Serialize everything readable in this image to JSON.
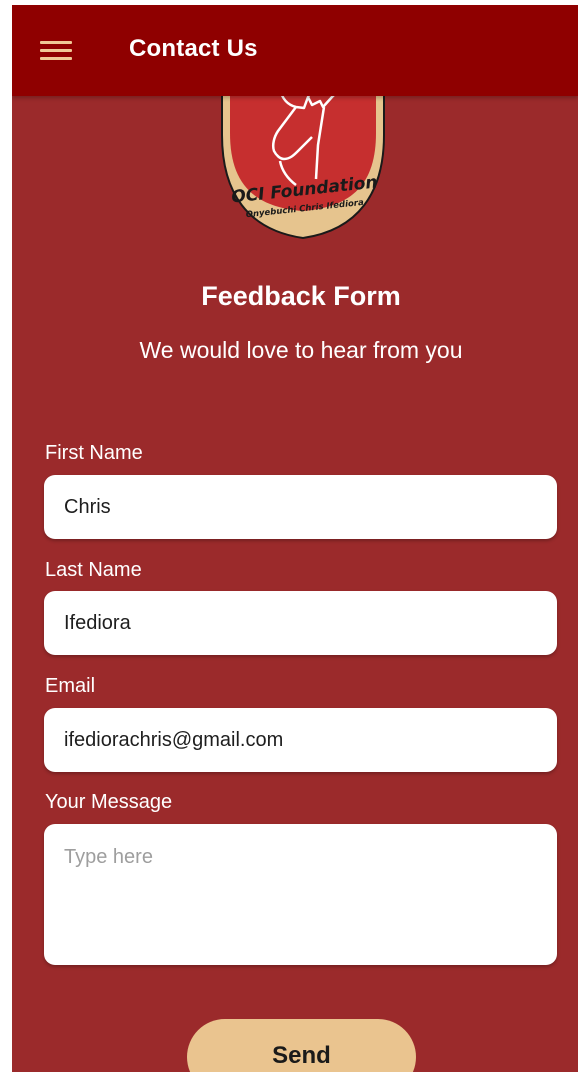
{
  "appbar": {
    "title": "Contact Us",
    "menu_icon": "hamburger-menu-icon"
  },
  "logo": {
    "name": "OCI Foundation",
    "tagline": "Onyebuchi Chris Ifediora",
    "colors": {
      "red": "#c62f2f",
      "gold": "#e6c48e",
      "dark": "#1a1a1a"
    }
  },
  "form": {
    "title": "Feedback Form",
    "subtitle": "We would love to hear from you",
    "first_name": {
      "label": "First Name",
      "value": "Chris"
    },
    "last_name": {
      "label": "Last Name",
      "value": "Ifediora"
    },
    "email": {
      "label": "Email",
      "value": "ifediorachris@gmail.com"
    },
    "message": {
      "label": "Your Message",
      "value": "",
      "placeholder": "Type here"
    },
    "send_label": "Send"
  },
  "colors": {
    "appbar": "#8f0000",
    "background": "#9b2a2b",
    "accent": "#eac48f"
  }
}
